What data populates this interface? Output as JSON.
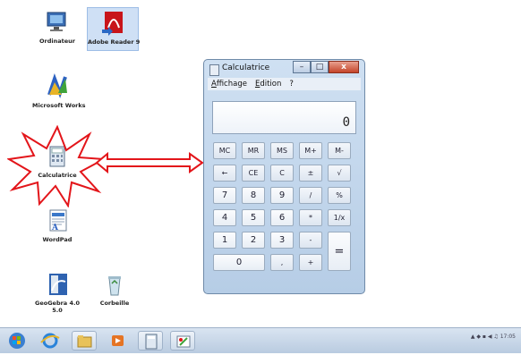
{
  "desktop": {
    "icons": [
      {
        "label": "Ordinateur"
      },
      {
        "label": "Adobe Reader 9"
      },
      {
        "label": "Microsoft Works"
      },
      {
        "label": "Calculatrice"
      },
      {
        "label": "WordPad"
      },
      {
        "label": "GeoGebra 4.0",
        "label2": "5.0"
      },
      {
        "label": "Corbeille"
      }
    ]
  },
  "window": {
    "title": "Calculatrice",
    "buttons": {
      "minimize": "–",
      "maximize": "□",
      "close": "x"
    },
    "menu": [
      "Affichage",
      "Edition",
      "?"
    ],
    "display": "0"
  },
  "keys": {
    "mc": "MC",
    "mr": "MR",
    "ms": "MS",
    "mplus": "M+",
    "mminus": "M-",
    "back": "←",
    "ce": "CE",
    "c": "C",
    "plusminus": "±",
    "sqrt": "√",
    "n7": "7",
    "n8": "8",
    "n9": "9",
    "div": "/",
    "pct": "%",
    "n4": "4",
    "n5": "5",
    "n6": "6",
    "mul": "*",
    "inv": "1/x",
    "n1": "1",
    "n2": "2",
    "n3": "3",
    "sub": "-",
    "eq": "=",
    "n0": "0",
    "dot": ",",
    "add": "+"
  },
  "taskbar": {
    "clock": "17:05"
  }
}
